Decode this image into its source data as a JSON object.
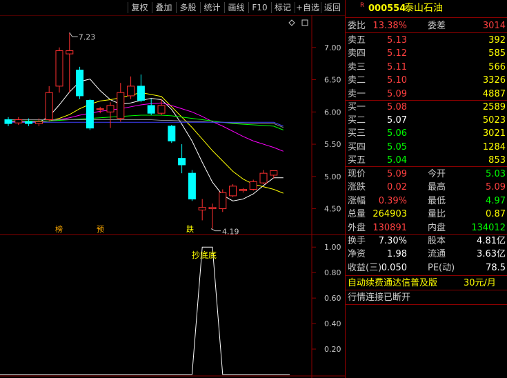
{
  "toolbar": {
    "items": [
      "复权",
      "叠加",
      "多股",
      "统计",
      "画线",
      "F10",
      "标记",
      "+自选",
      "返回"
    ]
  },
  "stock": {
    "badge": "R",
    "code": "000554",
    "name": "泰山石油"
  },
  "commission": {
    "ratio_label": "委比",
    "ratio": "13.38%",
    "diff_label": "委差",
    "diff": "3014"
  },
  "asks": [
    {
      "label": "卖五",
      "price": "5.13",
      "vol": "392"
    },
    {
      "label": "卖四",
      "price": "5.12",
      "vol": "585"
    },
    {
      "label": "卖三",
      "price": "5.11",
      "vol": "566"
    },
    {
      "label": "卖二",
      "price": "5.10",
      "vol": "3326"
    },
    {
      "label": "卖一",
      "price": "5.09",
      "vol": "4887"
    }
  ],
  "bids": [
    {
      "label": "买一",
      "price": "5.08",
      "vol": "2589"
    },
    {
      "label": "买二",
      "price": "5.07",
      "vol": "5023"
    },
    {
      "label": "买三",
      "price": "5.06",
      "vol": "3021"
    },
    {
      "label": "买四",
      "price": "5.05",
      "vol": "1284"
    },
    {
      "label": "买五",
      "price": "5.04",
      "vol": "853"
    }
  ],
  "quote": [
    {
      "l1": "现价",
      "v1": "5.09",
      "l2": "今开",
      "v2": "5.03"
    },
    {
      "l1": "涨跌",
      "v1": "0.02",
      "l2": "最高",
      "v2": "5.09"
    },
    {
      "l1": "涨幅",
      "v1": "0.39%",
      "l2": "最低",
      "v2": "4.97"
    },
    {
      "l1": "总量",
      "v1": "264903",
      "l2": "量比",
      "v2": "0.87"
    },
    {
      "l1": "外盘",
      "v1": "130891",
      "l2": "内盘",
      "v2": "134012"
    }
  ],
  "fundamentals": [
    {
      "l1": "换手",
      "v1": "7.30%",
      "l2": "股本",
      "v2": "4.81亿"
    },
    {
      "l1": "净资",
      "v1": "1.98",
      "l2": "流通",
      "v2": "3.63亿"
    },
    {
      "l1": "收益(三)",
      "v1": "0.050",
      "l2": "PE(动)",
      "v2": "78.5"
    }
  ],
  "promo": {
    "text": "自动续费通达信普及版",
    "price": "30元/月"
  },
  "status": "行情连接已断开",
  "chart_labels": {
    "high_label": "7.23",
    "low_label": "4.19",
    "markers": [
      "榜",
      "预",
      "跌"
    ],
    "signal": "抄底底"
  },
  "chart_data": [
    {
      "type": "candlestick",
      "y_ticks": [
        "7.00",
        "6.50",
        "6.00",
        "5.50",
        "5.00",
        "4.50"
      ],
      "ylim": [
        4.1,
        7.5
      ],
      "candles": [
        {
          "o": 5.88,
          "c": 5.82,
          "h": 5.92,
          "l": 5.78
        },
        {
          "o": 5.83,
          "c": 5.88,
          "h": 5.92,
          "l": 5.8
        },
        {
          "o": 5.85,
          "c": 5.82,
          "h": 5.9,
          "l": 5.78
        },
        {
          "o": 5.82,
          "c": 5.85,
          "h": 5.9,
          "l": 5.78
        },
        {
          "o": 5.88,
          "c": 6.3,
          "h": 6.4,
          "l": 5.85
        },
        {
          "o": 6.4,
          "c": 6.95,
          "h": 7.0,
          "l": 6.3
        },
        {
          "o": 6.9,
          "c": 6.95,
          "h": 7.23,
          "l": 6.3
        },
        {
          "o": 6.65,
          "c": 6.25,
          "h": 6.7,
          "l": 6.2
        },
        {
          "o": 6.18,
          "c": 5.75,
          "h": 6.2,
          "l": 5.72
        },
        {
          "o": 6.05,
          "c": 6.05,
          "h": 6.08,
          "l": 5.98
        },
        {
          "o": 6.0,
          "c": 6.1,
          "h": 6.15,
          "l": 5.75
        },
        {
          "o": 5.9,
          "c": 6.3,
          "h": 6.45,
          "l": 5.85
        },
        {
          "o": 6.25,
          "c": 6.4,
          "h": 6.55,
          "l": 6.2
        },
        {
          "o": 6.4,
          "c": 6.18,
          "h": 6.58,
          "l": 6.15
        },
        {
          "o": 6.1,
          "c": 5.98,
          "h": 6.2,
          "l": 5.95
        },
        {
          "o": 5.98,
          "c": 6.1,
          "h": 6.2,
          "l": 5.95
        },
        {
          "o": 5.78,
          "c": 5.55,
          "h": 5.8,
          "l": 5.52
        },
        {
          "o": 5.28,
          "c": 5.18,
          "h": 5.5,
          "l": 5.05
        },
        {
          "o": 5.05,
          "c": 4.65,
          "h": 5.1,
          "l": 4.62
        },
        {
          "o": 4.48,
          "c": 4.52,
          "h": 4.65,
          "l": 4.32
        },
        {
          "o": 4.5,
          "c": 4.52,
          "h": 4.58,
          "l": 4.19
        },
        {
          "o": 4.5,
          "c": 4.75,
          "h": 4.8,
          "l": 4.45
        },
        {
          "o": 4.7,
          "c": 4.85,
          "h": 4.88,
          "l": 4.68
        },
        {
          "o": 4.78,
          "c": 4.8,
          "h": 4.82,
          "l": 4.75
        },
        {
          "o": 4.8,
          "c": 4.92,
          "h": 4.95,
          "l": 4.78
        },
        {
          "o": 4.9,
          "c": 5.05,
          "h": 5.1,
          "l": 4.88
        },
        {
          "o": 5.02,
          "c": 5.09,
          "h": 5.09,
          "l": 4.97
        }
      ],
      "ma": [
        {
          "color": "#ffffff",
          "values": [
            5.85,
            5.84,
            5.84,
            5.84,
            5.93,
            6.11,
            6.31,
            6.47,
            6.51,
            6.33,
            6.19,
            6.12,
            6.14,
            6.18,
            6.21,
            6.19,
            6.04,
            5.81,
            5.55,
            5.22,
            4.91,
            4.71,
            4.62,
            4.65,
            4.73,
            4.86,
            4.98
          ]
        },
        {
          "color": "#ffff00",
          "values": [
            5.86,
            5.86,
            5.85,
            5.85,
            5.86,
            5.9,
            5.96,
            6.05,
            6.12,
            6.17,
            6.19,
            6.22,
            6.26,
            6.3,
            6.27,
            6.24,
            6.08,
            5.92,
            5.76,
            5.58,
            5.4,
            5.24,
            5.08,
            4.96,
            4.88,
            4.84,
            4.8
          ]
        },
        {
          "color": "#ff00ff",
          "values": [
            5.85,
            5.85,
            5.85,
            5.85,
            5.86,
            5.88,
            5.91,
            5.95,
            5.98,
            6.01,
            6.03,
            6.05,
            6.08,
            6.11,
            6.13,
            6.14,
            6.1,
            6.05,
            6.0,
            5.93,
            5.85,
            5.78,
            5.7,
            5.62,
            5.55,
            5.5,
            5.45
          ]
        },
        {
          "color": "#00ff00",
          "values": [
            5.86,
            5.86,
            5.86,
            5.86,
            5.86,
            5.87,
            5.88,
            5.89,
            5.9,
            5.91,
            5.92,
            5.93,
            5.94,
            5.95,
            5.95,
            5.95,
            5.94,
            5.92,
            5.9,
            5.88,
            5.86,
            5.84,
            5.82,
            5.81,
            5.8,
            5.79,
            5.78
          ]
        },
        {
          "color": "#888888",
          "values": [
            5.88,
            5.88,
            5.88,
            5.88,
            5.88,
            5.88,
            5.88,
            5.88,
            5.88,
            5.88,
            5.88,
            5.88,
            5.88,
            5.88,
            5.88,
            5.87,
            5.87,
            5.86,
            5.85,
            5.85,
            5.84,
            5.84,
            5.83,
            5.83,
            5.82,
            5.82,
            5.82
          ]
        },
        {
          "color": "#4040ff",
          "values": [
            5.84,
            5.84,
            5.84,
            5.84,
            5.84,
            5.84,
            5.84,
            5.84,
            5.84,
            5.84,
            5.84,
            5.84,
            5.84,
            5.84,
            5.84,
            5.84,
            5.84,
            5.84,
            5.84,
            5.84,
            5.84,
            5.84,
            5.84,
            5.84,
            5.84,
            5.84,
            5.84
          ]
        }
      ]
    },
    {
      "type": "line",
      "y_ticks": [
        "1.00",
        "0.80",
        "0.60",
        "0.40",
        "0.20"
      ],
      "ylim": [
        0,
        1.05
      ],
      "values": [
        0,
        0,
        0,
        0,
        0,
        0,
        0,
        0,
        0,
        0,
        0,
        0,
        0,
        0,
        0,
        0,
        0,
        0,
        0,
        1,
        1,
        0,
        0,
        0,
        0,
        0,
        0
      ]
    }
  ],
  "colors": {
    "up": "#ff3030",
    "down": "#00ffff",
    "grid": "#8b0000",
    "axis": "#c8c8c8"
  }
}
